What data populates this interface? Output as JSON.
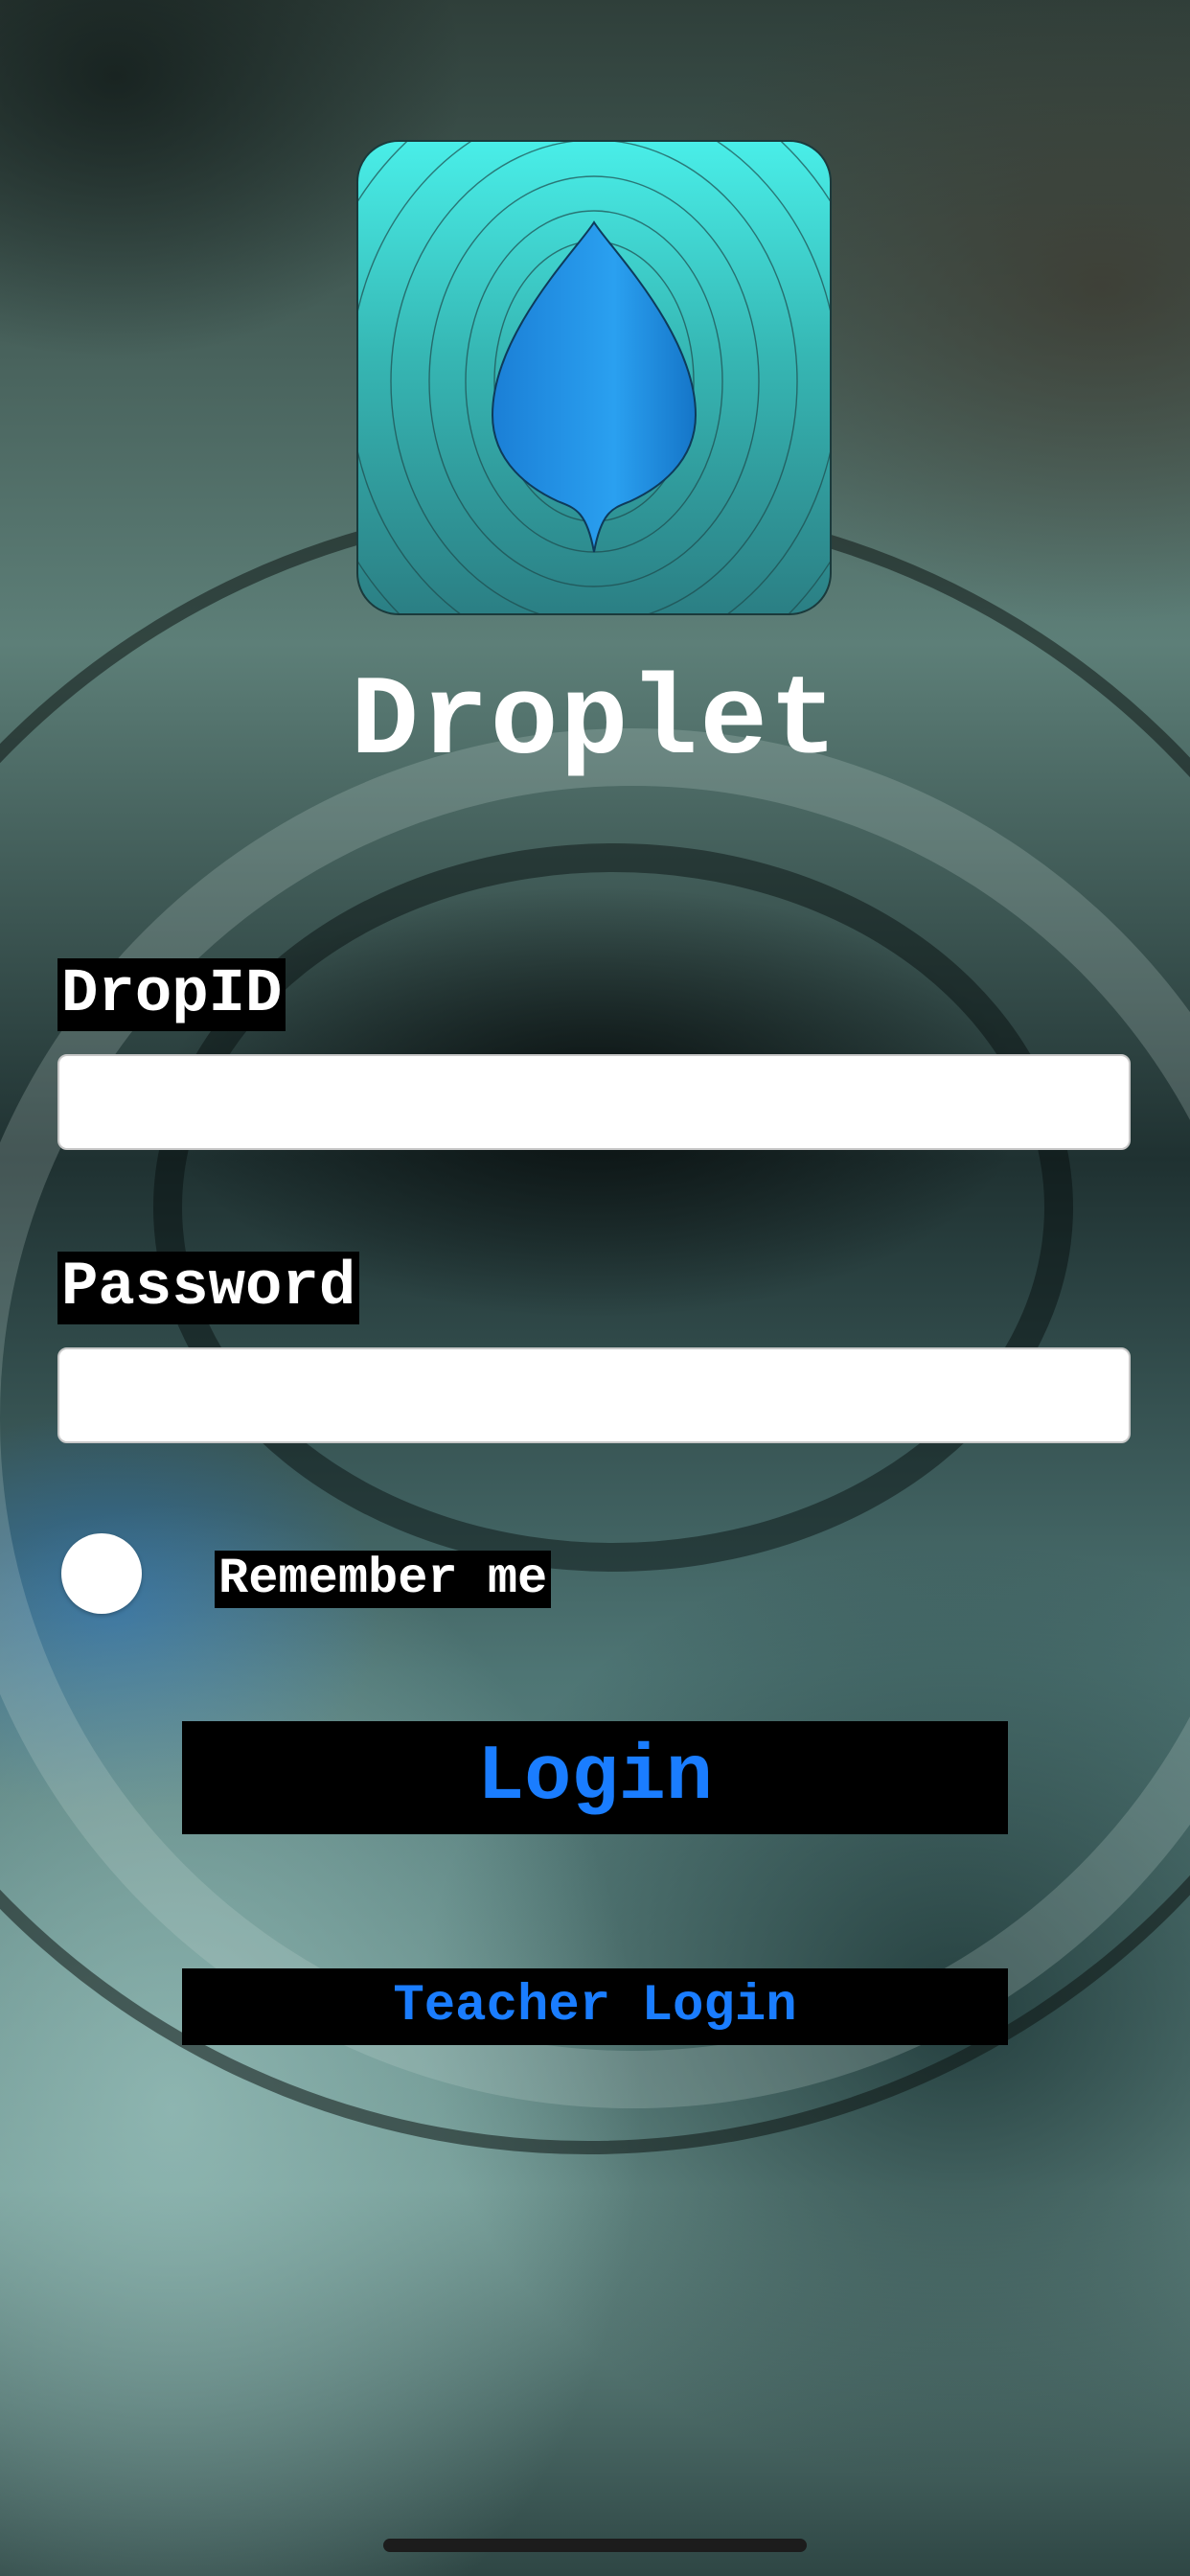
{
  "app": {
    "title": "Droplet",
    "icon": "droplet-app-icon"
  },
  "form": {
    "dropid_label": "DropID",
    "dropid_value": "",
    "password_label": "Password",
    "password_value": "",
    "remember_label": "Remember me",
    "remember_checked": false
  },
  "buttons": {
    "login_label": "Login",
    "teacher_login_label": "Teacher Login"
  },
  "colors": {
    "accent": "#1a7dff",
    "label_background": "#000000",
    "label_text": "#ffffff",
    "icon_top": "#49eee8",
    "icon_bottom": "#2b7f84",
    "drop": "#1f8ee0"
  }
}
